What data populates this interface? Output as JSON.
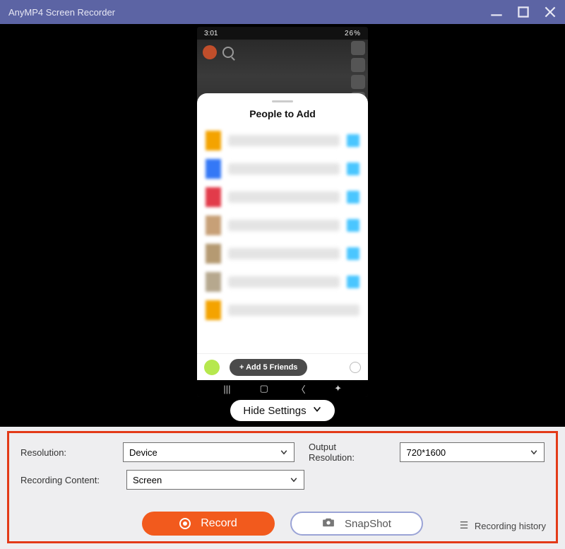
{
  "window": {
    "title": "AnyMP4 Screen Recorder"
  },
  "phone": {
    "status_time": "3:01",
    "status_right": "26%",
    "sheet_title": "People to Add",
    "add_friends_label": "+ Add 5 Friends"
  },
  "hide_settings_label": "Hide Settings",
  "settings": {
    "resolution_label": "Resolution:",
    "resolution_value": "Device",
    "output_label": "Output Resolution:",
    "output_value": "720*1600",
    "content_label": "Recording Content:",
    "content_value": "Screen"
  },
  "actions": {
    "record_label": "Record",
    "snapshot_label": "SnapShot",
    "history_label": "Recording history"
  }
}
